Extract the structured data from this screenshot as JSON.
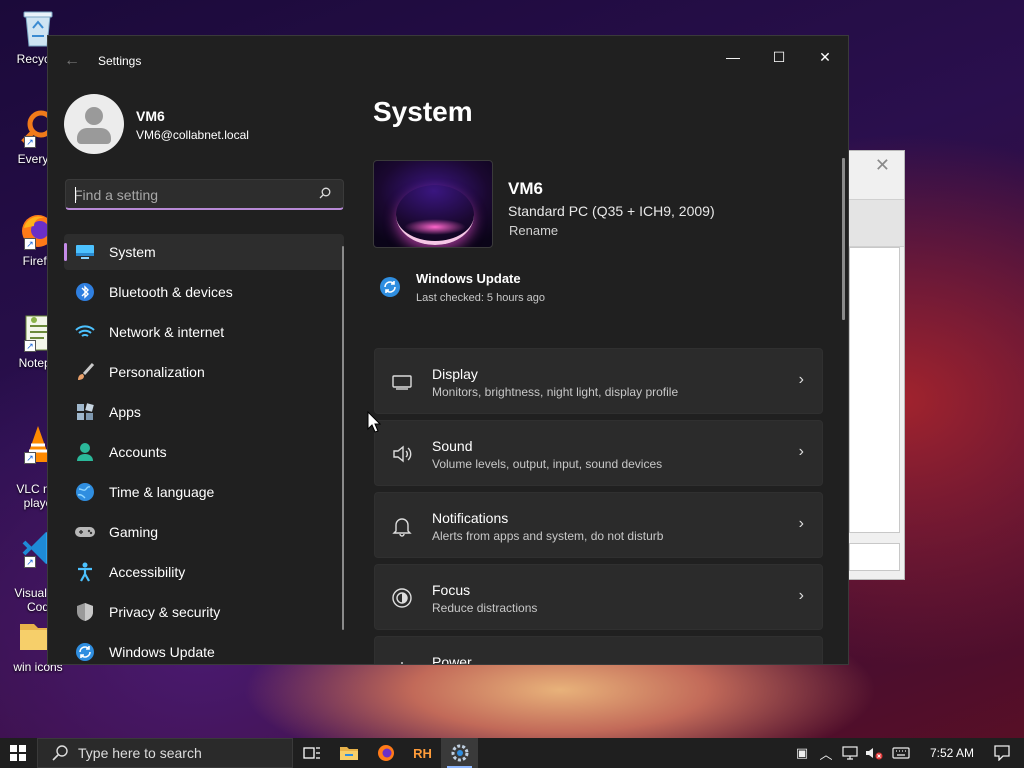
{
  "desktop": {
    "icons": [
      {
        "label": "Recycle",
        "icon": "recycle-bin-icon"
      },
      {
        "label": "Everyth",
        "icon": "everything-search-icon"
      },
      {
        "label": "Firefo",
        "icon": "firefox-icon"
      },
      {
        "label": "Notepa",
        "icon": "notepad-icon"
      },
      {
        "label": "VLC me\nplaye",
        "icon": "vlc-icon"
      },
      {
        "label": "Visual St\nCod",
        "icon": "vscode-icon"
      },
      {
        "label": "win icons",
        "icon": "folder-icon"
      }
    ]
  },
  "window": {
    "title": "Settings",
    "controls": {
      "minimize": "—",
      "maximize": "☐",
      "close": "✕"
    }
  },
  "profile": {
    "name": "VM6",
    "email": "VM6@collabnet.local"
  },
  "search": {
    "placeholder": "Find a setting"
  },
  "nav": {
    "items": [
      {
        "label": "System",
        "icon": "system-icon",
        "active": true
      },
      {
        "label": "Bluetooth & devices",
        "icon": "bluetooth-icon"
      },
      {
        "label": "Network & internet",
        "icon": "wifi-icon"
      },
      {
        "label": "Personalization",
        "icon": "brush-icon"
      },
      {
        "label": "Apps",
        "icon": "apps-icon"
      },
      {
        "label": "Accounts",
        "icon": "accounts-icon"
      },
      {
        "label": "Time & language",
        "icon": "globe-icon"
      },
      {
        "label": "Gaming",
        "icon": "gamepad-icon"
      },
      {
        "label": "Accessibility",
        "icon": "accessibility-icon"
      },
      {
        "label": "Privacy & security",
        "icon": "shield-icon"
      },
      {
        "label": "Windows Update",
        "icon": "update-icon"
      }
    ]
  },
  "main": {
    "title": "System",
    "device": {
      "name": "VM6",
      "model": "Standard PC (Q35 + ICH9, 2009)",
      "rename": "Rename"
    },
    "update": {
      "title": "Windows Update",
      "subtitle": "Last checked: 5 hours ago"
    },
    "cards": [
      {
        "title": "Display",
        "subtitle": "Monitors, brightness, night light, display profile",
        "icon": "display-icon"
      },
      {
        "title": "Sound",
        "subtitle": "Volume levels, output, input, sound devices",
        "icon": "speaker-icon"
      },
      {
        "title": "Notifications",
        "subtitle": "Alerts from apps and system, do not disturb",
        "icon": "bell-icon"
      },
      {
        "title": "Focus",
        "subtitle": "Reduce distractions",
        "icon": "focus-icon"
      },
      {
        "title": "Power",
        "subtitle": "",
        "icon": "power-icon"
      }
    ]
  },
  "taskbar": {
    "search_placeholder": "Type here to search",
    "apps": [
      "task-view-icon",
      "file-explorer-icon",
      "firefox-icon",
      "rh-app-icon",
      "settings-gear-icon"
    ],
    "time": "7:52 AM"
  },
  "colors": {
    "accent": "#c58ae8",
    "window_bg": "#202020",
    "card_bg": "#2b2b2b",
    "update_blue": "#4cc2ff"
  }
}
